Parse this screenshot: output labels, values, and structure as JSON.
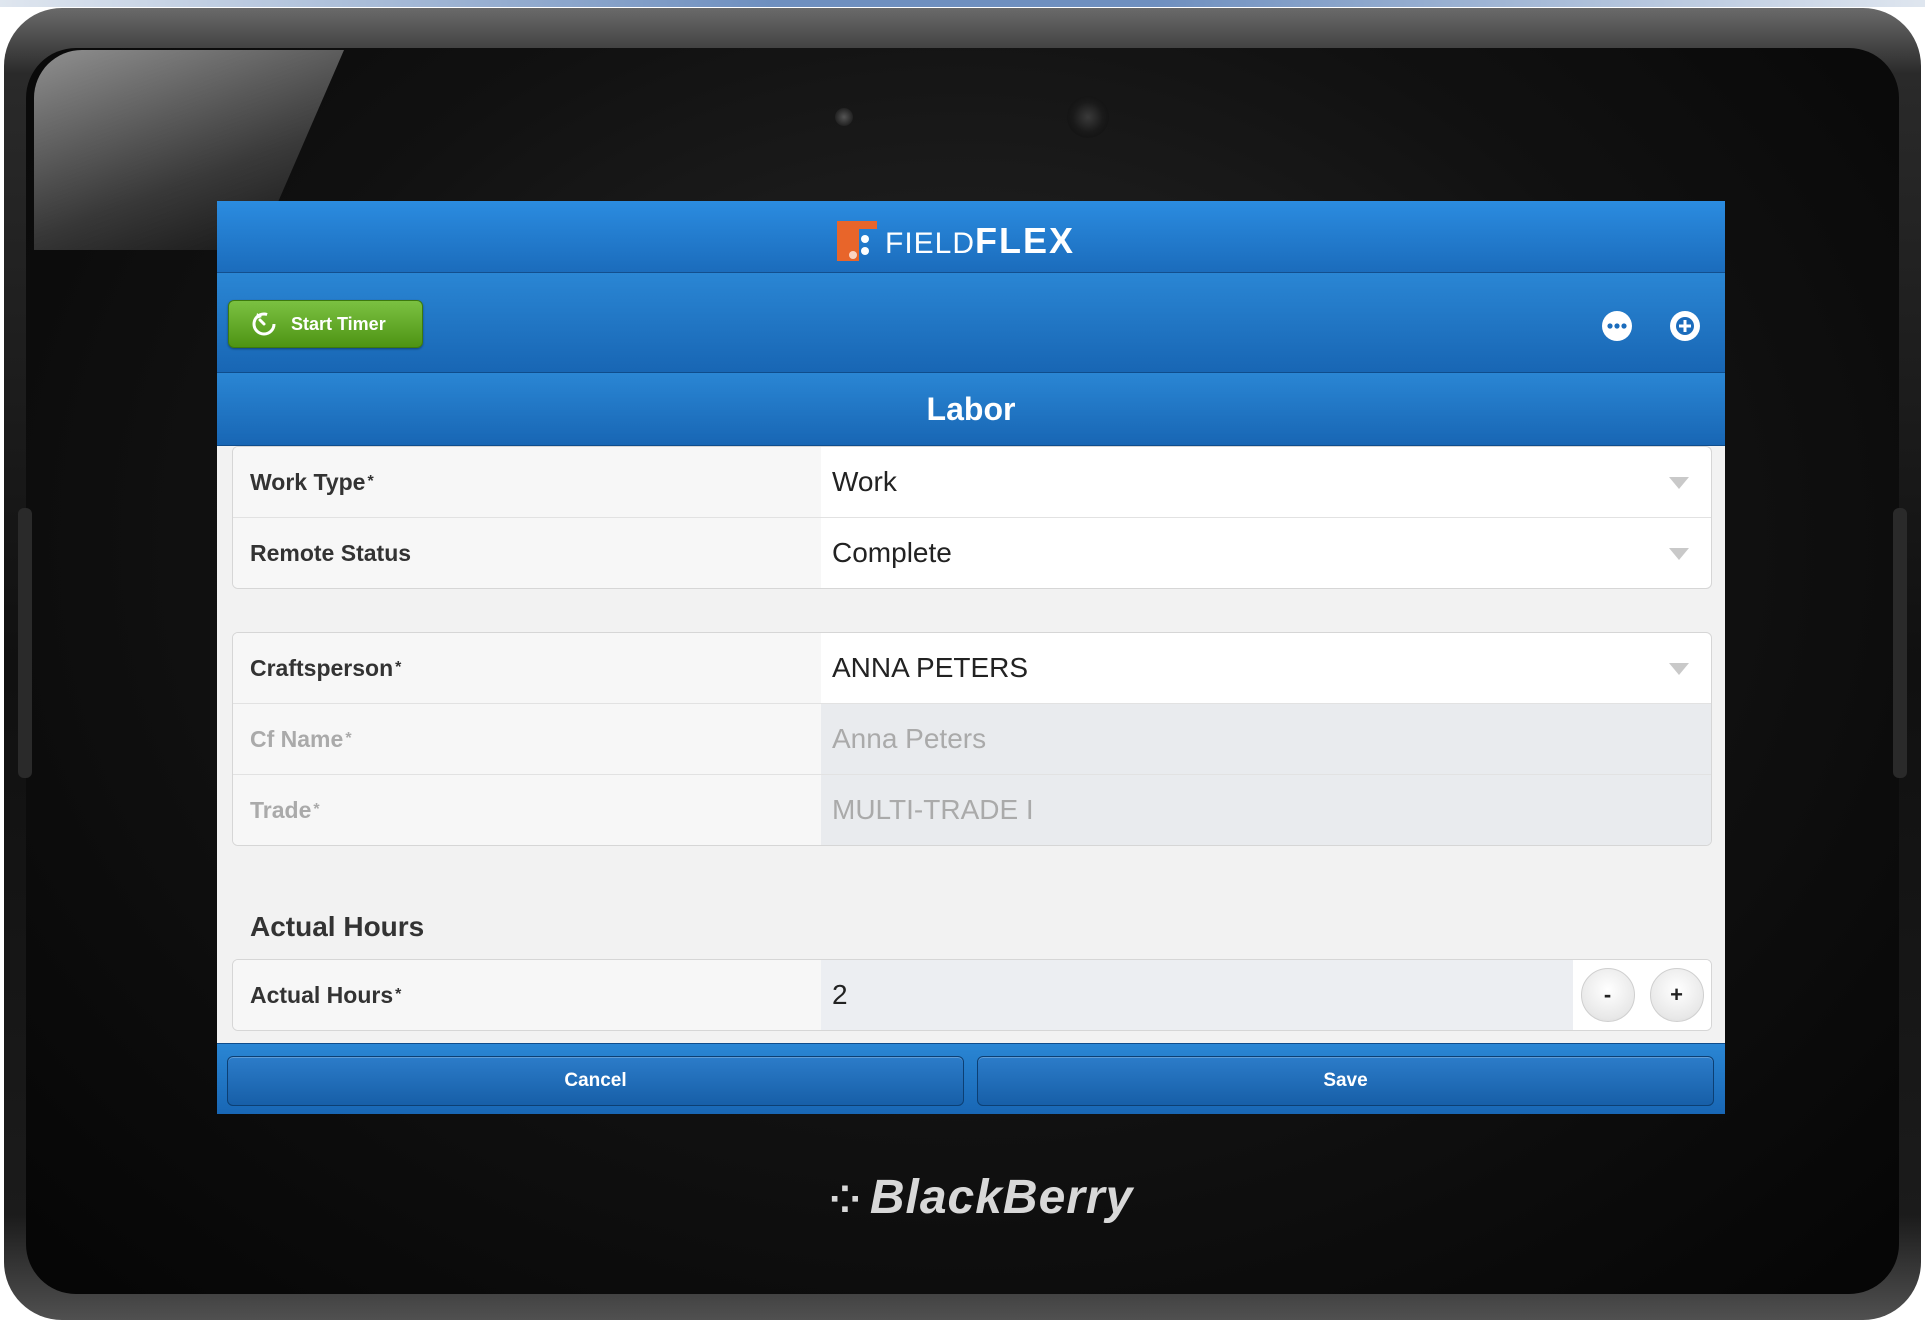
{
  "device": {
    "brand": "BlackBerry",
    "brand_mark": "blackberry-logo"
  },
  "app": {
    "brand_prefix": "FIELD",
    "brand_suffix": "FLEX",
    "brand_color": "#e8652a",
    "accent": "#1b6cbc"
  },
  "toolbar": {
    "start_timer_label": "Start Timer",
    "timer_icon": "stopwatch-icon",
    "more_icon": "more-icon",
    "add_icon": "add-icon"
  },
  "page": {
    "title": "Labor"
  },
  "form": {
    "work_type": {
      "label": "Work Type",
      "required": "*",
      "value": "Work"
    },
    "remote_status": {
      "label": "Remote Status",
      "value": "Complete"
    },
    "craftsperson": {
      "label": "Craftsperson",
      "required": "*",
      "value": "ANNA PETERS"
    },
    "cf_name": {
      "label": "Cf Name",
      "required": "*",
      "value": "Anna Peters"
    },
    "trade": {
      "label": "Trade",
      "required": "*",
      "value": "MULTI-TRADE I"
    },
    "actual_hours_section": "Actual Hours",
    "actual_hours": {
      "label": "Actual Hours",
      "required": "*",
      "value": "2",
      "minus": "-",
      "plus": "+"
    }
  },
  "footer": {
    "cancel_label": "Cancel",
    "save_label": "Save"
  }
}
